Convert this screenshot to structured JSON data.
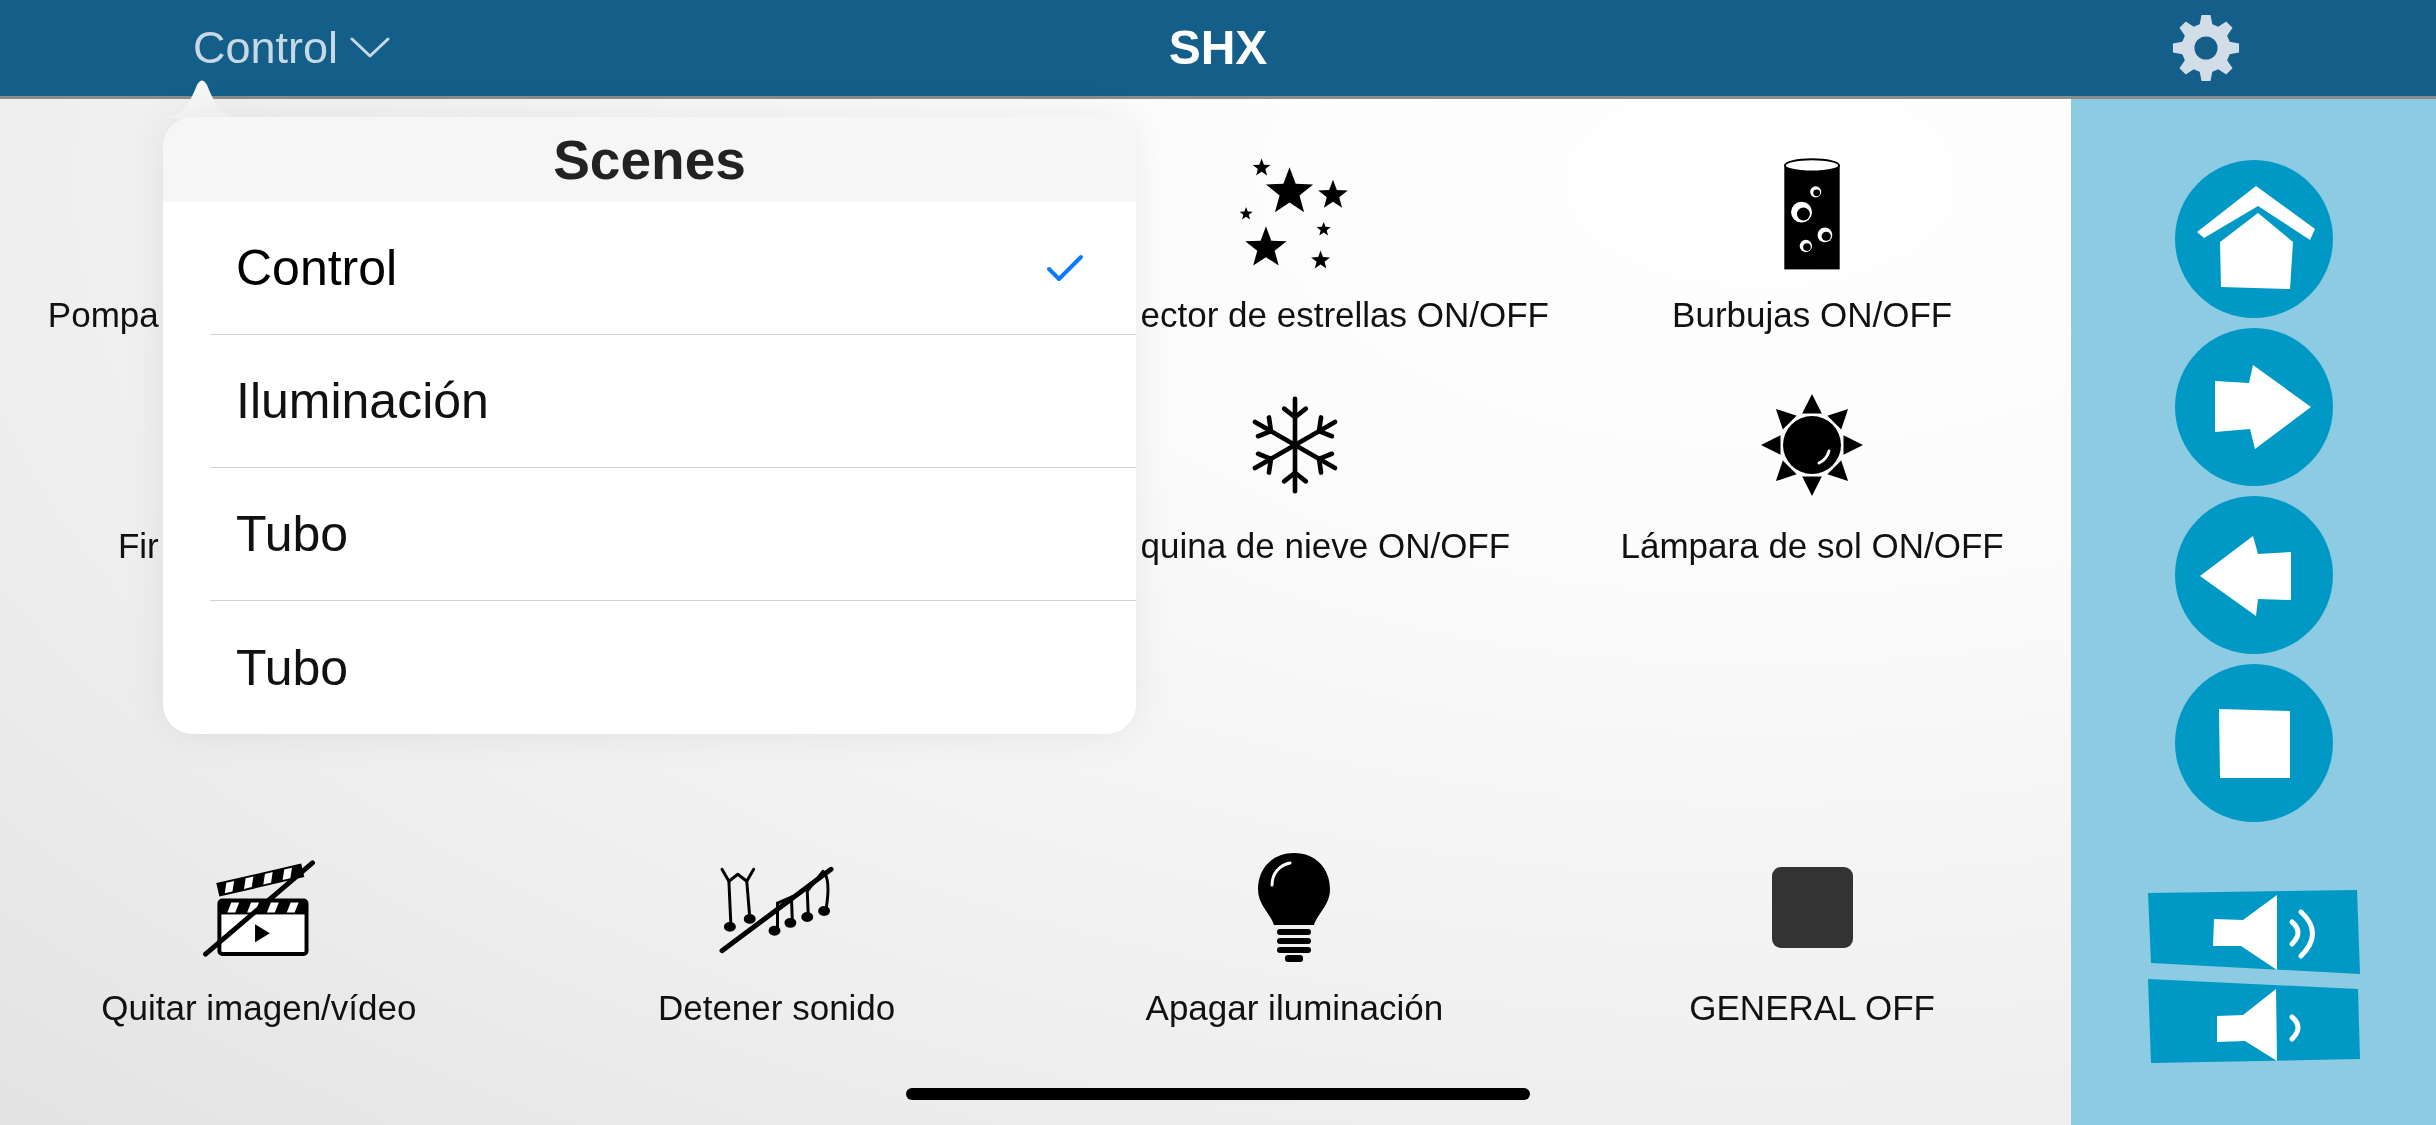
{
  "header": {
    "scene_selector": {
      "label": "Control",
      "expanded": true
    },
    "title": "SHX"
  },
  "scenes_popover": {
    "title": "Scenes",
    "items": [
      {
        "label": "Control",
        "selected": true
      },
      {
        "label": "Iluminación",
        "selected": false
      },
      {
        "label": "Tubo",
        "selected": false
      },
      {
        "label": "Tubo",
        "selected": false
      }
    ]
  },
  "tiles": [
    {
      "kind": "cut_end",
      "label": "Pompa"
    },
    {
      "kind": "cut_start",
      "label": "ector de estrellas ON/OFF"
    },
    {
      "kind": "full",
      "label": "Burbujas ON/OFF"
    },
    {
      "kind": "cut_end",
      "label": "Fir"
    },
    {
      "kind": "cut_start",
      "label": "quina de nieve ON/OFF"
    },
    {
      "kind": "full",
      "label": "Lámpara de sol ON/OFF"
    },
    {
      "kind": "full",
      "label": "Quitar imagen/vídeo"
    },
    {
      "kind": "full",
      "label": "Detener sonido"
    },
    {
      "kind": "full",
      "label": "Apagar iluminación"
    },
    {
      "kind": "full",
      "label": "GENERAL OFF"
    }
  ]
}
